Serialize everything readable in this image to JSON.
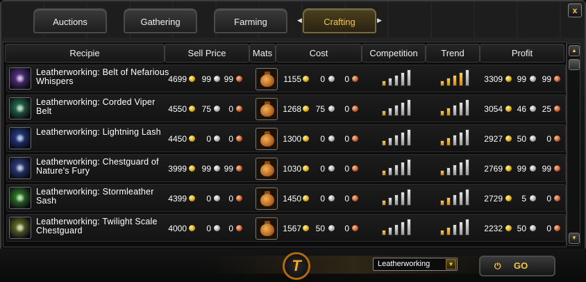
{
  "tabs": [
    {
      "label": "Auctions",
      "active": false
    },
    {
      "label": "Gathering",
      "active": false
    },
    {
      "label": "Farming",
      "active": false
    },
    {
      "label": "Crafting",
      "active": true
    }
  ],
  "close_label": "x",
  "columns": [
    "Recipie",
    "Sell Price",
    "Mats",
    "Cost",
    "Competition",
    "Trend",
    "Profit"
  ],
  "colors": {
    "gold": "#f2c84b",
    "active_tab_text": "#f2c84b"
  },
  "rows": [
    {
      "name": "Leatherworking: Belt of Nefarious Whispers",
      "icon": "belt-purple-icon",
      "icon_color": "#6a3ea0",
      "sell": {
        "g": "4699",
        "s": "99",
        "c": "99"
      },
      "cost": {
        "g": "1155",
        "s": "0",
        "c": "0"
      },
      "competition_level": 1,
      "trend_level": 4,
      "profit": {
        "g": "3309",
        "s": "99",
        "c": "99"
      }
    },
    {
      "name": "Leatherworking: Corded Viper Belt",
      "icon": "belt-green-icon",
      "icon_color": "#2f8a5a",
      "sell": {
        "g": "4550",
        "s": "75",
        "c": "0"
      },
      "cost": {
        "g": "1268",
        "s": "75",
        "c": "0"
      },
      "competition_level": 1,
      "trend_level": 2,
      "profit": {
        "g": "3054",
        "s": "46",
        "c": "25"
      }
    },
    {
      "name": "Leatherworking: Lightning Lash",
      "icon": "lash-blue-icon",
      "icon_color": "#2a4aa0",
      "sell": {
        "g": "4450",
        "s": "0",
        "c": "0"
      },
      "cost": {
        "g": "1300",
        "s": "0",
        "c": "0"
      },
      "competition_level": 1,
      "trend_level": 2,
      "profit": {
        "g": "2927",
        "s": "50",
        "c": "0"
      }
    },
    {
      "name": "Leatherworking: Chestguard of Nature's Fury",
      "icon": "chestguard-blue-icon",
      "icon_color": "#3a4e9a",
      "sell": {
        "g": "3999",
        "s": "99",
        "c": "99"
      },
      "cost": {
        "g": "1030",
        "s": "0",
        "c": "0"
      },
      "competition_level": 1,
      "trend_level": 1,
      "profit": {
        "g": "2769",
        "s": "99",
        "c": "99"
      }
    },
    {
      "name": "Leatherworking: Stormleather Sash",
      "icon": "sash-green-icon",
      "icon_color": "#3a9a2a",
      "sell": {
        "g": "4399",
        "s": "0",
        "c": "0"
      },
      "cost": {
        "g": "1450",
        "s": "0",
        "c": "0"
      },
      "competition_level": 1,
      "trend_level": 2,
      "profit": {
        "g": "2729",
        "s": "5",
        "c": "0"
      }
    },
    {
      "name": "Leatherworking: Twilight Scale Chestguard",
      "icon": "chestguard-olive-icon",
      "icon_color": "#7a8a2a",
      "sell": {
        "g": "4000",
        "s": "0",
        "c": "0"
      },
      "cost": {
        "g": "1567",
        "s": "50",
        "c": "0"
      },
      "competition_level": 1,
      "trend_level": 2,
      "profit": {
        "g": "2232",
        "s": "50",
        "c": "0"
      }
    }
  ],
  "logo_letter": "T",
  "profession_select": "Leatherworking",
  "go_label": "GO"
}
